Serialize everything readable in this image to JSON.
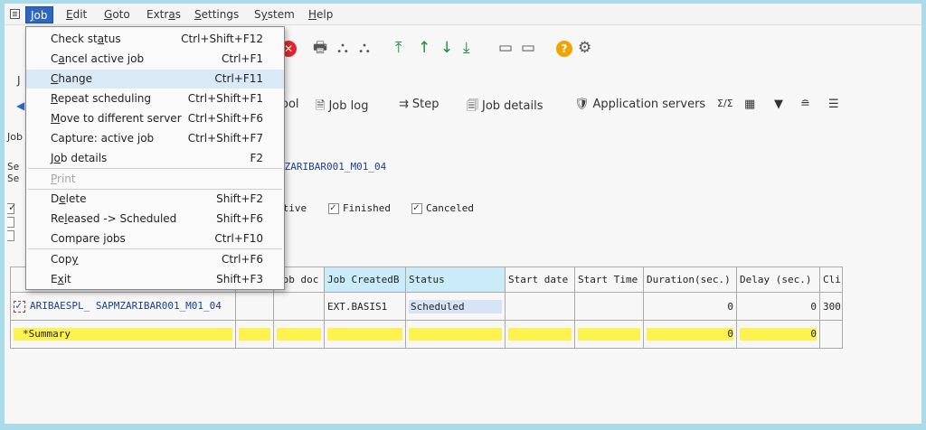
{
  "menubar": {
    "items": [
      {
        "label": "Job",
        "ul": "J",
        "rest": "ob"
      },
      {
        "label": "Edit",
        "ul": "E",
        "rest": "dit"
      },
      {
        "label": "Goto",
        "ul": "G",
        "rest": "oto"
      },
      {
        "label": "Extras",
        "pre": "Extr",
        "ul": "a",
        "rest": "s"
      },
      {
        "label": "Settings",
        "ul": "S",
        "rest": "ettings"
      },
      {
        "label": "System",
        "pre": "S",
        "ul": "y",
        "rest": "stem"
      },
      {
        "label": "Help",
        "ul": "H",
        "rest": "elp"
      }
    ]
  },
  "menu": {
    "items": [
      {
        "pre": "Check st",
        "ul": "a",
        "rest": "tus",
        "shortcut": "Ctrl+Shift+F12"
      },
      {
        "pre": "C",
        "ul": "a",
        "rest": "ncel active job",
        "shortcut": "Ctrl+F1"
      },
      {
        "pre": "",
        "ul": "C",
        "rest": "hange",
        "shortcut": "Ctrl+F11"
      },
      {
        "pre": "",
        "ul": "R",
        "rest": "epeat scheduling",
        "shortcut": "Ctrl+Shift+F1"
      },
      {
        "pre": "",
        "ul": "M",
        "rest": "ove to different server",
        "shortcut": "Ctrl+Shift+F6"
      },
      {
        "pre": "Capture: active job",
        "ul": "",
        "rest": "",
        "shortcut": "Ctrl+Shift+F7"
      },
      {
        "pre": "J",
        "ul": "o",
        "rest": "b details",
        "shortcut": "F2"
      },
      {
        "pre": "",
        "ul": "P",
        "rest": "rint",
        "shortcut": ""
      },
      {
        "pre": "D",
        "ul": "e",
        "rest": "lete",
        "shortcut": "Shift+F2"
      },
      {
        "pre": "Re",
        "ul": "l",
        "rest": "eased -> Scheduled",
        "shortcut": "Shift+F6"
      },
      {
        "pre": "Compare ",
        "ul": "j",
        "rest": "obs",
        "shortcut": "Ctrl+F10"
      },
      {
        "pre": "Cop",
        "ul": "y",
        "rest": "",
        "shortcut": "Ctrl+F6"
      },
      {
        "pre": "E",
        "ul": "x",
        "rest": "it",
        "shortcut": "Shift+F3"
      }
    ]
  },
  "apptoolbar": {
    "spool_frag": "ool",
    "job_log": "Job log",
    "step": "Step",
    "job_details": "Job details",
    "app_servers": "Application servers",
    "sum_icon": "Σ/Σ"
  },
  "left": {
    "title_frag": "J",
    "job_frag": "Job",
    "se1": "Se",
    "se2": "Se",
    "active_frag": "ctive"
  },
  "selection": {
    "jobname_frag": "MZARIBAR001_M01_04"
  },
  "status_filters": {
    "finished": "Finished",
    "canceled": "Canceled"
  },
  "grid": {
    "headers": [
      "Job doc",
      "Job CreatedB",
      "Status",
      "Start date",
      "Start Time",
      "Duration(sec.)",
      "Delay (sec.)",
      "Cli"
    ],
    "row": {
      "jobname": "ARIBAESPL_ SAPMZARIBAR001_M01_04",
      "created_by": "EXT.BASIS1",
      "status": "Scheduled",
      "duration": "0",
      "delay": "0",
      "client": "300"
    },
    "summary": {
      "label": "*Summary",
      "duration": "0",
      "delay": "0"
    }
  }
}
